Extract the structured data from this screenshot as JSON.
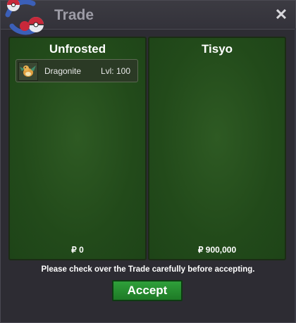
{
  "window": {
    "title": "Trade",
    "close_icon": "close-icon"
  },
  "panels": [
    {
      "player": "Unfrosted",
      "items": [
        {
          "icon": "dragonite-sprite-icon",
          "name": "Dragonite",
          "level": "Lvl: 100"
        }
      ],
      "money": "₽ 0"
    },
    {
      "player": "Tisyo",
      "items": [],
      "money": "₽ 900,000"
    }
  ],
  "notice": "Please check over the Trade carefully before accepting.",
  "accept_label": "Accept",
  "colors": {
    "panel_green": "#224a1a",
    "accept_green": "#2fa03a",
    "window_bg": "#2d2c33"
  }
}
